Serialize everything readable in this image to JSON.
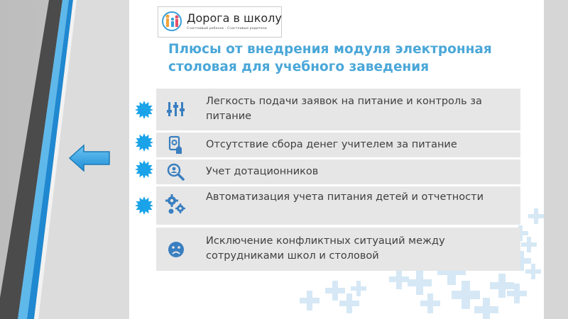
{
  "logo": {
    "name": "Дорога в школу",
    "tagline": "Счастливый ребенок · Счастливые родители"
  },
  "title": "Плюсы от внедрения модуля электронная столовая для учебного заведения",
  "items": [
    {
      "icon": "sliders-icon",
      "text": "Легкость подачи заявок на питание и контроль за питание"
    },
    {
      "icon": "hand-money-icon",
      "text": "Отсутствие сбора денег учителем за питание"
    },
    {
      "icon": "search-user-icon",
      "text": "Учет дотационников"
    },
    {
      "icon": "gears-icon",
      "text": "Автоматизация учета питания детей и отчетности"
    },
    {
      "icon": "sad-face-icon",
      "text": "Исключение конфликтных ситуаций между сотрудниками школ и столовой"
    }
  ],
  "colors": {
    "accent": "#4aa7d8",
    "row_bg": "#e6e6e6",
    "badge": "#1aa3e8",
    "stripe_dark": "#4b4b4b"
  }
}
